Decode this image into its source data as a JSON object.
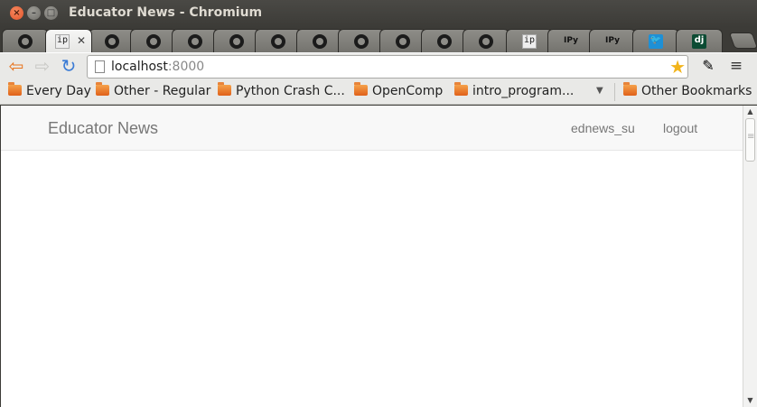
{
  "window": {
    "title": "Educator News - Chromium"
  },
  "tabs": [
    {
      "icon": "github-icon"
    },
    {
      "icon": "ip-icon",
      "favicon_text": "ip",
      "active": true
    },
    {
      "icon": "github-icon"
    },
    {
      "icon": "github-icon"
    },
    {
      "icon": "github-icon"
    },
    {
      "icon": "github-icon"
    },
    {
      "icon": "github-icon"
    },
    {
      "icon": "github-icon"
    },
    {
      "icon": "github-icon"
    },
    {
      "icon": "github-icon"
    },
    {
      "icon": "github-icon"
    },
    {
      "icon": "github-icon"
    },
    {
      "icon": "ip-icon",
      "favicon_text": "ip"
    },
    {
      "icon": "ipython-icon",
      "favicon_text": "IPy"
    },
    {
      "icon": "ipython-icon",
      "favicon_text": "IPy"
    },
    {
      "icon": "twitter-icon"
    },
    {
      "icon": "django-icon",
      "favicon_text": "dj"
    }
  ],
  "toolbar": {
    "url_host": "localhost",
    "url_port": ":8000"
  },
  "bookmarks": {
    "items": [
      {
        "label": "Every Day"
      },
      {
        "label": "Other - Regular"
      },
      {
        "label": "Python Crash C..."
      },
      {
        "label": "OpenComp"
      },
      {
        "label": "intro_program..."
      }
    ],
    "other": "Other Bookmarks"
  },
  "page": {
    "brand": "Educator News",
    "nav": {
      "user": "ednews_su",
      "logout": "logout"
    }
  },
  "colors": {
    "titlebar": "#3c3b37",
    "toolbar": "#e9e9e7",
    "navbar_bg": "#f8f8f8",
    "navbar_text": "#777777",
    "star": "#f2b41b",
    "reload": "#3a7bd5",
    "back_arrow": "#e8731c"
  }
}
